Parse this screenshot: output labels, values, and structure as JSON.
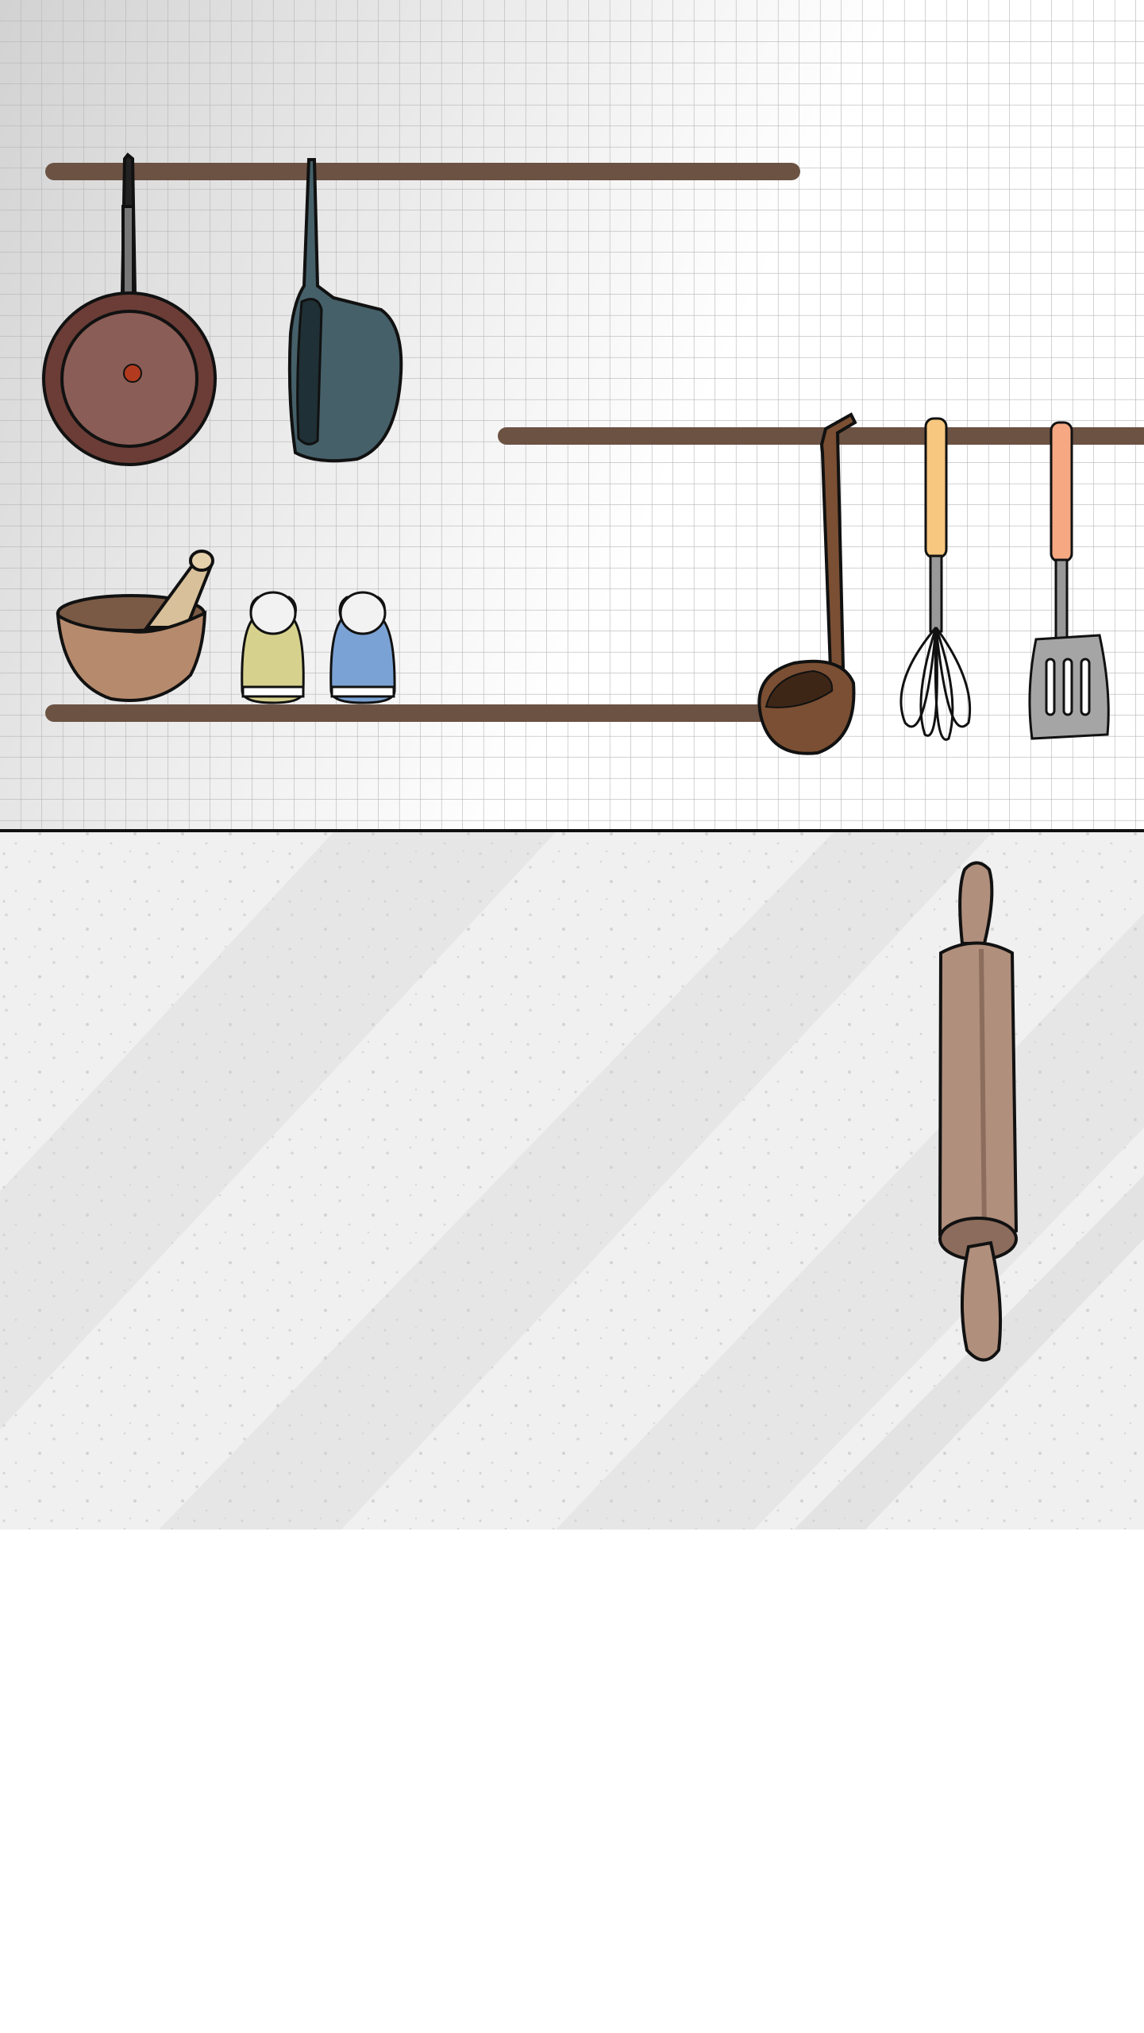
{
  "scene": {
    "colors": {
      "wall_light": "#ffffff",
      "wall_dark": "#d4d4d4",
      "grid_line": "#b8b8b8",
      "rail": "#6b5243",
      "counter": "#efefef",
      "counter_streak": "#e4e4e4",
      "outline": "#111111",
      "frying_pan": "#8a5d56",
      "frying_pan_rim": "#6b3d36",
      "pot": "#456069",
      "pot_inner": "#1f3036",
      "mortar": "#b68a6c",
      "pestle": "#d8c09a",
      "shaker_yellow": "#d6d28e",
      "shaker_blue": "#7aa2d4",
      "ladle": "#7b4f33",
      "whisk_handle": "#f7c77f",
      "spatula_handle": "#f5a882",
      "spatula_head": "#a5a5a5",
      "rolling_pin": "#b08f7c",
      "rolling_pin_end": "#8c6c5c"
    },
    "items": [
      "frying-pan-icon",
      "pot-icon",
      "mortar-pestle-icon",
      "salt-shaker-icon",
      "pepper-shaker-icon",
      "ladle-icon",
      "whisk-icon",
      "spatula-icon",
      "rolling-pin-icon"
    ]
  }
}
